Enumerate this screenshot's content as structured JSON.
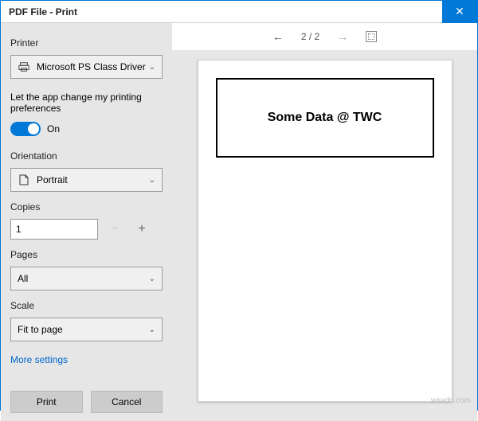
{
  "title": "PDF File - Print",
  "printer": {
    "label": "Printer",
    "value": "Microsoft PS Class Driver"
  },
  "preferences": {
    "text": "Let the app change my printing preferences",
    "toggle_label": "On"
  },
  "orientation": {
    "label": "Orientation",
    "value": "Portrait"
  },
  "copies": {
    "label": "Copies",
    "value": "1"
  },
  "pages": {
    "label": "Pages",
    "value": "All"
  },
  "scale": {
    "label": "Scale",
    "value": "Fit to page"
  },
  "more_settings": "More settings",
  "buttons": {
    "print": "Print",
    "cancel": "Cancel"
  },
  "preview": {
    "page_indicator": "2 / 2",
    "content": "Some Data @ TWC"
  },
  "watermark": "wsxdn.com"
}
